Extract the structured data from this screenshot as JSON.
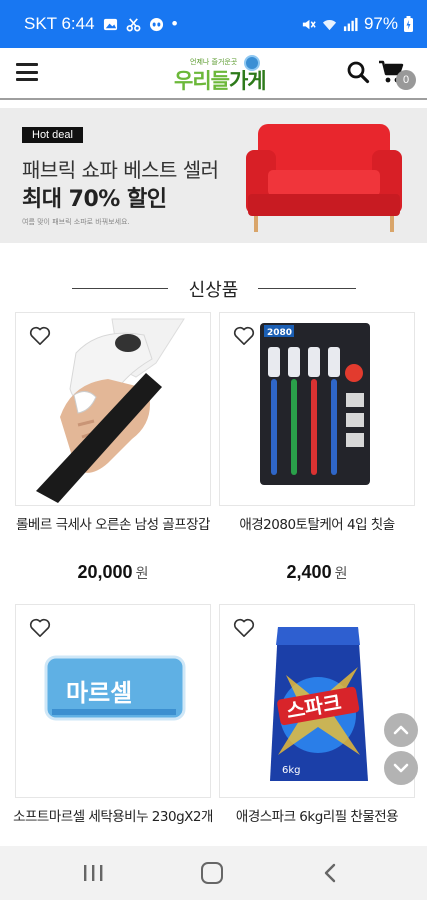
{
  "status_bar": {
    "carrier_time": "SKT 6:44",
    "dot": "•",
    "battery": "97%",
    "icons": [
      "gallery-icon",
      "scissors-icon",
      "alien-icon",
      "mute-icon",
      "wifi-icon",
      "signal-icon",
      "battery-icon"
    ]
  },
  "header": {
    "logo_subtitle": "언제나 즐거운곳",
    "logo_text_a": "우리들",
    "logo_text_b": "가게",
    "cart_count": "0",
    "icons": [
      "menu-icon",
      "search-icon",
      "cart-icon"
    ]
  },
  "banner": {
    "tag": "Hot deal",
    "title": "패브릭 쇼파 베스트 셀러",
    "sale": "최대 70% 할인",
    "description": "여름 맞이 패브릭 소파로 바꿔보세요."
  },
  "section": {
    "title": "신상품"
  },
  "products": [
    {
      "name": "롤베르 극세사 오른손 남성 골프장갑",
      "price": "20,000",
      "currency": "원"
    },
    {
      "name": "애경2080토탈케어 4입 칫솔",
      "price": "2,400",
      "currency": "원"
    },
    {
      "name": "소프트마르셀 세탁용비누 230gX2개",
      "price": "",
      "currency": ""
    },
    {
      "name": "애경스파크 6kg리필 찬물전용",
      "price": "",
      "currency": ""
    }
  ],
  "product_images": {
    "soap_label": "마르셀",
    "detergent_label": "스파크",
    "detergent_weight": "6kg",
    "toothbrush_label": "2080"
  },
  "colors": {
    "status_bar": "#1877f2",
    "banner_bg": "#ececec",
    "logo_green": "#6cb83a",
    "sofa_red": "#e8262d"
  }
}
